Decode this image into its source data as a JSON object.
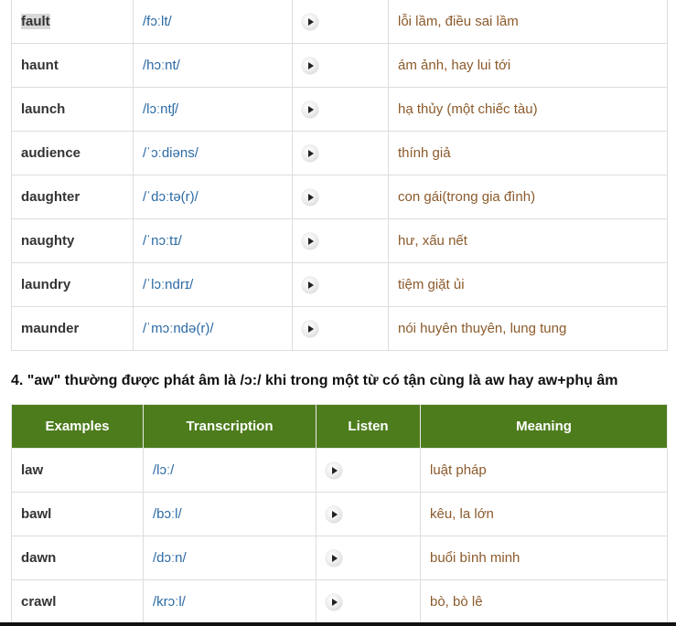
{
  "table1": {
    "rows": [
      {
        "word": "fault",
        "ipa": "/fɔːlt/",
        "meaning": "lỗi lầm, điều sai lầm"
      },
      {
        "word": "haunt",
        "ipa": "/hɔːnt/",
        "meaning": "ám ảnh, hay lui tới"
      },
      {
        "word": "launch",
        "ipa": "/lɔːntʃ/",
        "meaning": "hạ thủy (một chiếc tàu)"
      },
      {
        "word": "audience",
        "ipa": "/ˈɔːdiəns/",
        "meaning": "thính giả"
      },
      {
        "word": "daughter",
        "ipa": "/ˈdɔːtə(r)/",
        "meaning": "con gái(trong gia đình)"
      },
      {
        "word": "naughty",
        "ipa": "/ˈnɔːtɪ/",
        "meaning": "hư, xấu nết"
      },
      {
        "word": "laundry",
        "ipa": "/ˈlɔːndrɪ/",
        "meaning": "tiệm giặt ủi"
      },
      {
        "word": "maunder",
        "ipa": "/ˈmɔːndə(r)/",
        "meaning": "nói huyên thuyên, lung tung"
      }
    ]
  },
  "section4": {
    "heading": "4. \"aw\" thường được phát âm là /ɔ:/ khi trong một từ có tận cùng là aw hay aw+phụ âm"
  },
  "table2": {
    "headers": [
      "Examples",
      "Transcription",
      "Listen",
      "Meaning"
    ],
    "rows": [
      {
        "word": "law",
        "ipa": "/lɔː/",
        "meaning": "luật pháp"
      },
      {
        "word": "bawl",
        "ipa": "/bɔːl/",
        "meaning": "kêu, la lớn"
      },
      {
        "word": "dawn",
        "ipa": "/dɔːn/",
        "meaning": "buổi bình minh"
      },
      {
        "word": "crawl",
        "ipa": "/krɔːl/",
        "meaning": "bò, bò lê"
      }
    ]
  },
  "icons": {
    "play": "play-icon"
  }
}
